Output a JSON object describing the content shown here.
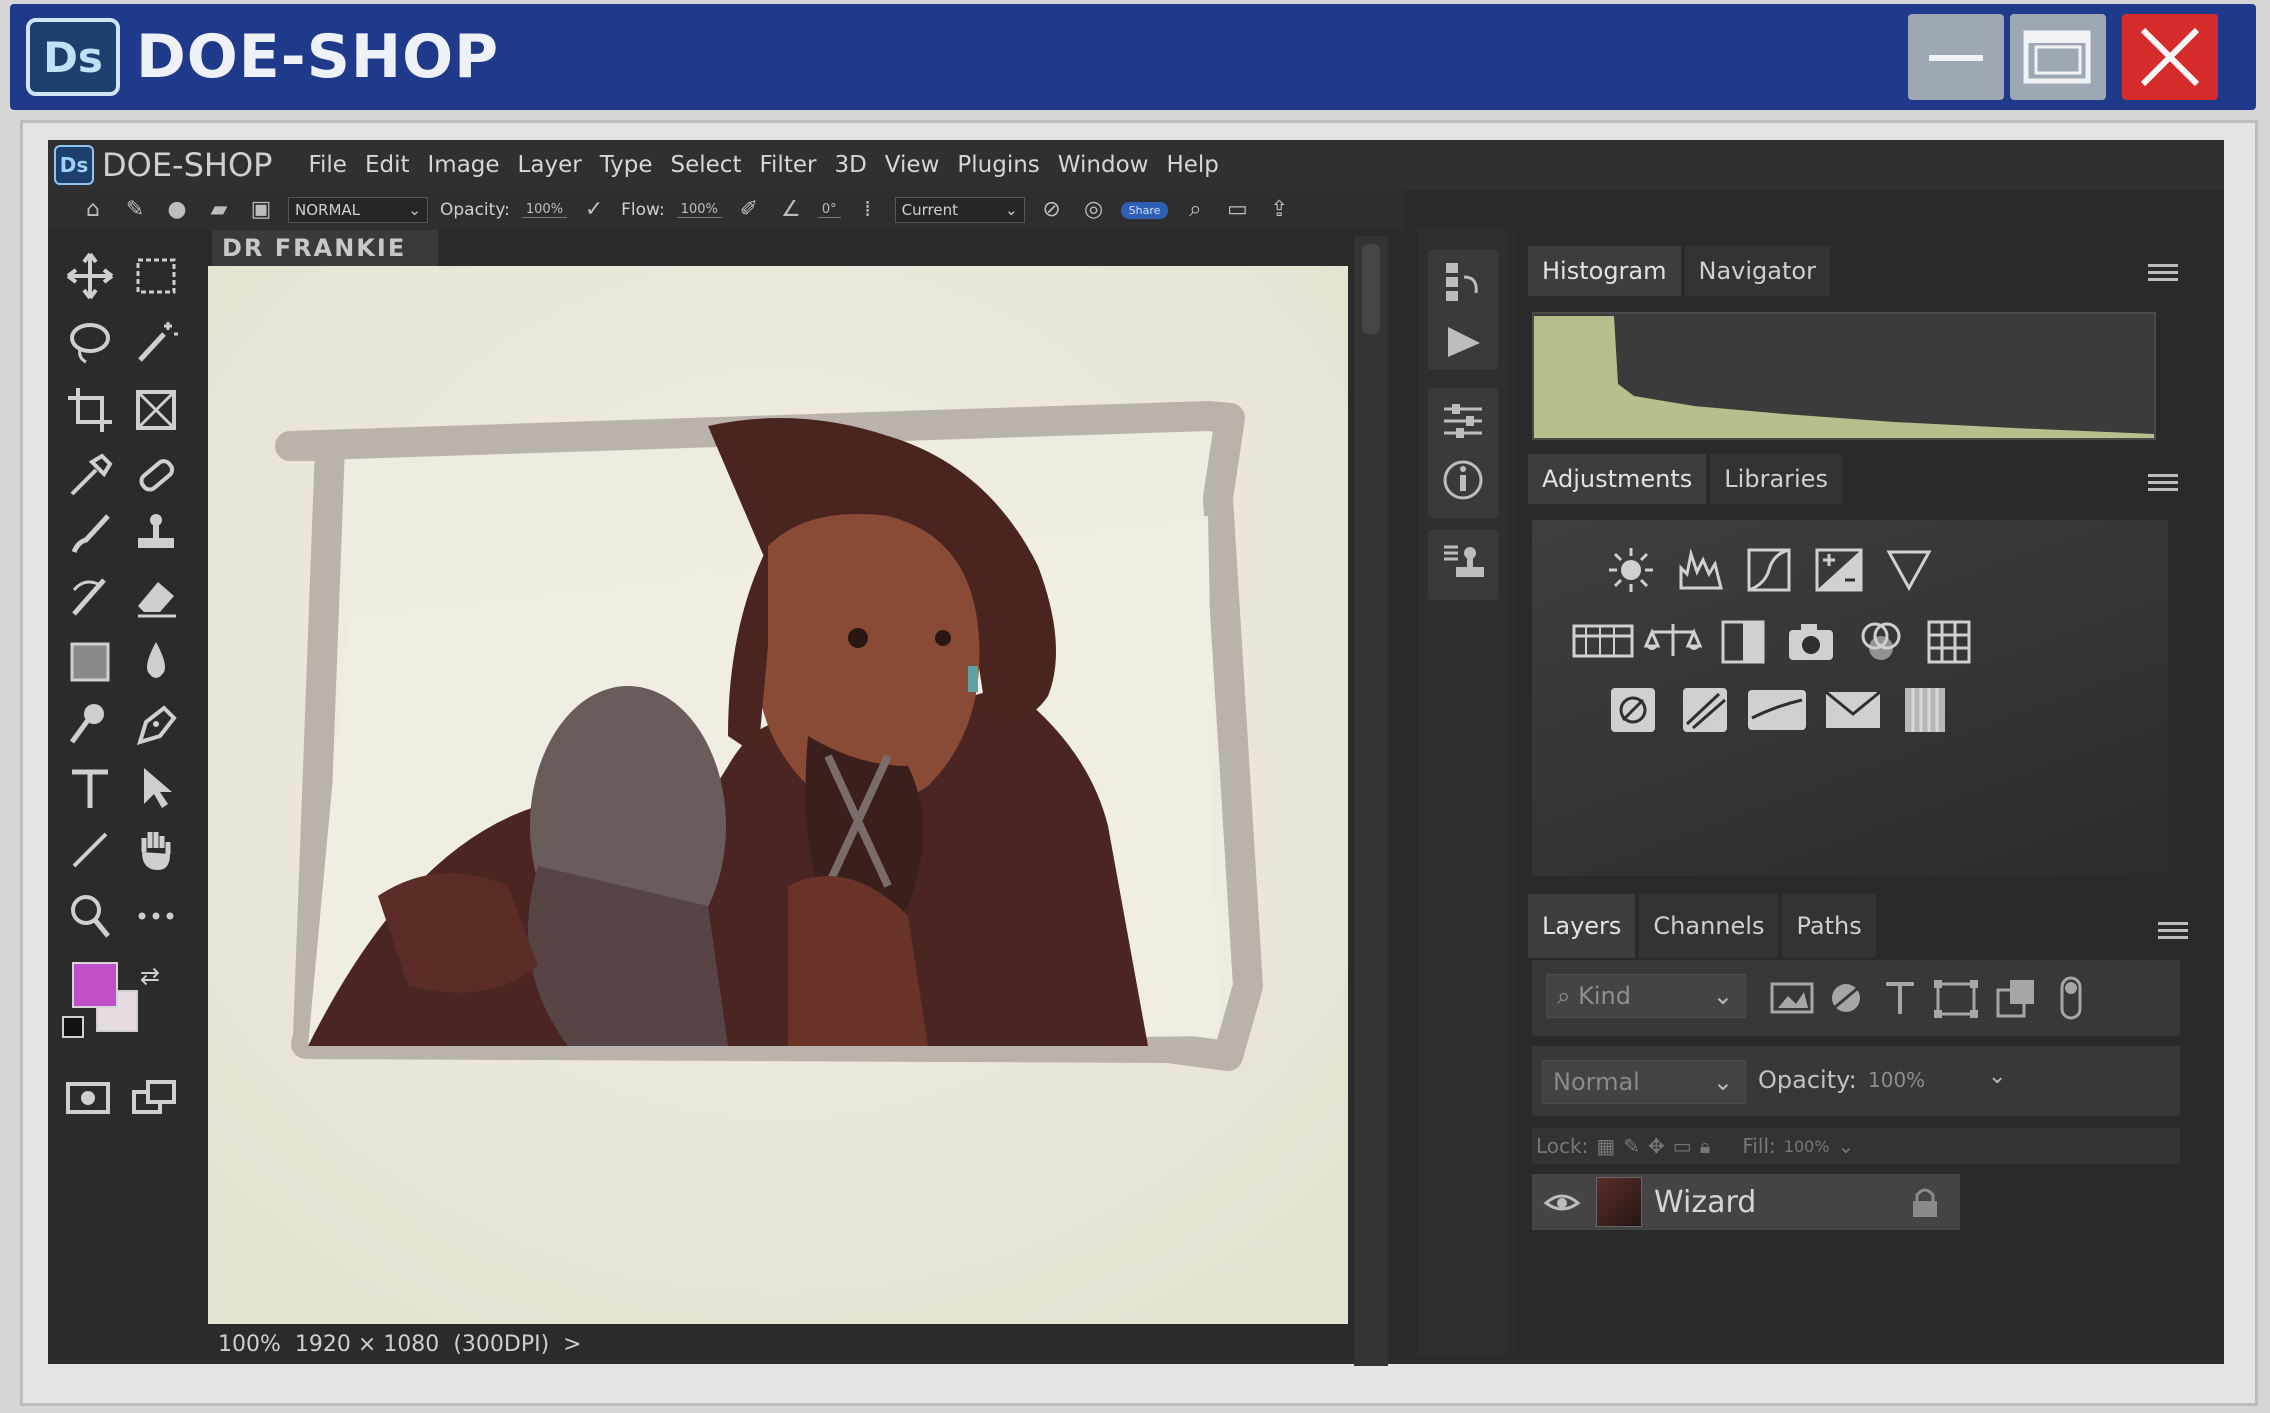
{
  "window": {
    "logo": "Ds",
    "title": "DOE-SHOP",
    "controls": [
      "minimize-icon",
      "maximize-icon",
      "close-icon"
    ],
    "accent": "#1f3a8a",
    "close_color": "#d52b2b"
  },
  "app": {
    "logo": "Ds",
    "name": "DOE-SHOP",
    "menu": [
      "File",
      "Edit",
      "Image",
      "Layer",
      "Type",
      "Select",
      "Filter",
      "3D",
      "View",
      "Plugins",
      "Window",
      "Help"
    ]
  },
  "options": {
    "blend_mode": "NORMAL",
    "opacity_label": "Opacity:",
    "opacity_value": "100%",
    "flow_label": "Flow:",
    "flow_value": "100%",
    "angle_value": "0°",
    "sample": "Current",
    "share_label": "Share"
  },
  "toolbox": {
    "foreground_color": "#c150c8",
    "background_color": "#e6dbe0"
  },
  "document": {
    "tab_title": "DR FRANKIE",
    "canvas_color": "#ecebdf"
  },
  "status": {
    "zoom": "100%",
    "dimensions": "1920 × 1080",
    "resolution": "(300DPI)",
    "more": ">"
  },
  "panels": {
    "top_tabs": [
      "Histogram",
      "Navigator"
    ],
    "middle_tabs": [
      "Adjustments",
      "Libraries"
    ],
    "layer_tabs": [
      "Layers",
      "Channels",
      "Paths"
    ],
    "histogram_color": "#b9bf8c",
    "kind_filter": "Kind",
    "blend_mode": "Normal",
    "opacity_label": "Opacity:",
    "opacity_value": "100%",
    "lock_label": "Lock:",
    "fill_label": "Fill:",
    "fill_value": "100%",
    "layers": [
      {
        "name": "Wizard",
        "visible": true,
        "locked": true
      }
    ]
  }
}
